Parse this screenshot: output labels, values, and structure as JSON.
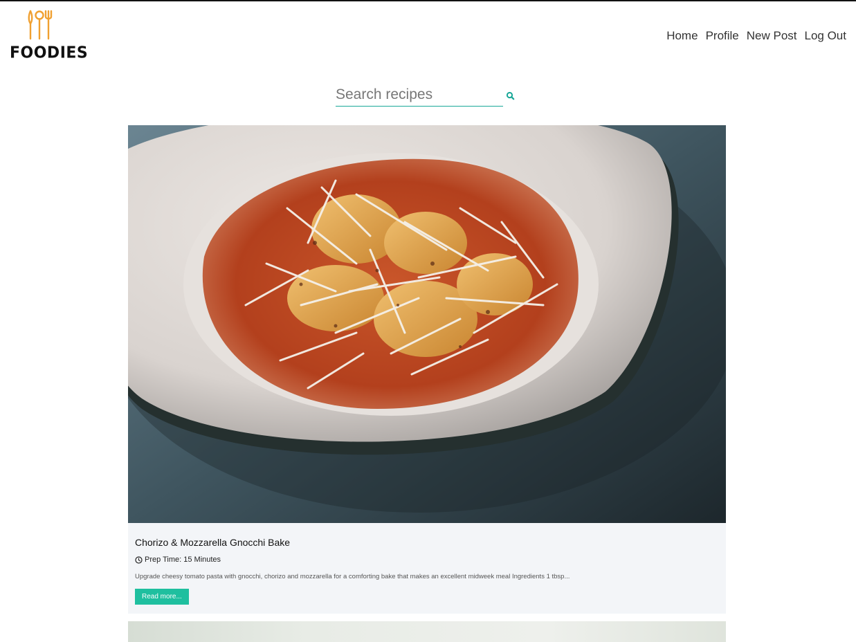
{
  "brand": {
    "name": "FOODIES",
    "logo_icon": "cutlery-icon",
    "accent": "#f0a030"
  },
  "nav": [
    "Home",
    "Profile",
    "New Post",
    "Log Out"
  ],
  "search": {
    "placeholder": "Search recipes",
    "value": "",
    "icon": "search-icon"
  },
  "colors": {
    "primary": "#1fbf9f",
    "search_underline": "#18a797"
  },
  "recipes": [
    {
      "title": "Chorizo & Mozzarella Gnocchi Bake",
      "prep_time": "Prep Time: 15 Minutes",
      "description": "Upgrade cheesy tomato pasta with gnocchi, chorizo and mozzarella for a comforting bake that makes an excellent midweek meal Ingredients 1 tbsp...",
      "button": "Read more..."
    }
  ]
}
